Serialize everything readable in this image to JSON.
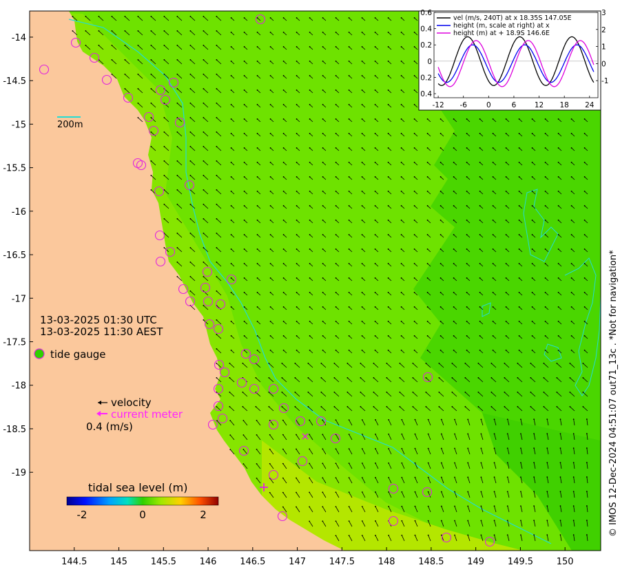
{
  "map": {
    "lat_ticks": [
      "-14",
      "-14.5",
      "-15",
      "-15.5",
      "-16",
      "-16.5",
      "-17",
      "-17.5",
      "-18",
      "-18.5",
      "-19"
    ],
    "lon_ticks": [
      "144.5",
      "145",
      "145.5",
      "146",
      "146.5",
      "147",
      "147.5",
      "148",
      "148.5",
      "149",
      "149.5",
      "150"
    ],
    "lat_range": [
      -19.9,
      -13.7
    ],
    "lon_range": [
      144.0,
      150.4
    ],
    "scale_bar_label": "200m",
    "colors": {
      "land": "#fbc89c",
      "sea_bright": "#6ee200",
      "sea_mid": "#4ad600",
      "sea_deep": "#3ccc00",
      "sea_coast": "#86e500",
      "yellowish": "#b8e800",
      "isobath": "#22dcd4",
      "gauge_ring": "#e020e0",
      "current_meter": "#ff20ff"
    }
  },
  "timestamps": {
    "utc": "13-03-2025 01:30 UTC",
    "aest": "13-03-2025 11:30 AEST"
  },
  "legend": {
    "tide_gauge_label": "tide gauge",
    "velocity_label": "velocity",
    "current_meter_label": "current meter",
    "velocity_scale_label": "0.4 (m/s)"
  },
  "colorbar": {
    "title": "tidal sea level (m)",
    "ticks": [
      "-2",
      "0",
      "2"
    ],
    "range": [
      -2.5,
      2.5
    ]
  },
  "chart_data": {
    "type": "line",
    "legend": [
      "vel (m/s, 240T) at x 18.35S 147.05E",
      "height (m, scale at right) at x",
      "height (m) at + 18.9S 146.6E"
    ],
    "x_ticks": [
      "-12",
      "-6",
      "0",
      "6",
      "12",
      "18",
      "24"
    ],
    "y_left_ticks": [
      "0.6",
      "0.4",
      "0.2",
      "0",
      "0.2",
      "0.4"
    ],
    "y_right_ticks": [
      "3",
      "2",
      "1",
      "0",
      "-1"
    ],
    "xlim": [
      -13,
      26
    ],
    "ylim_left": [
      -0.45,
      0.6
    ],
    "ylim_right": [
      -2,
      3
    ],
    "series": [
      {
        "name": "vel (m/s, 240T) at x 18.35S 147.05E",
        "color": "#000000",
        "amplitude": 0.3,
        "phase_hours": -5,
        "axis": "left"
      },
      {
        "name": "height (m, scale at right) at x",
        "color": "#0000ee",
        "amplitude": 1.1,
        "phase_hours": 8.6,
        "axis": "right"
      },
      {
        "name": "height (m) at + 18.9S 146.6E",
        "color": "#dd00dd",
        "amplitude": 1.35,
        "phase_hours": 9.4,
        "axis": "right"
      }
    ],
    "period_hours": 12.4
  },
  "credit": "© IMOS 12-Dec-2024 04:51:07 out71_13c . *Not for navigation*"
}
